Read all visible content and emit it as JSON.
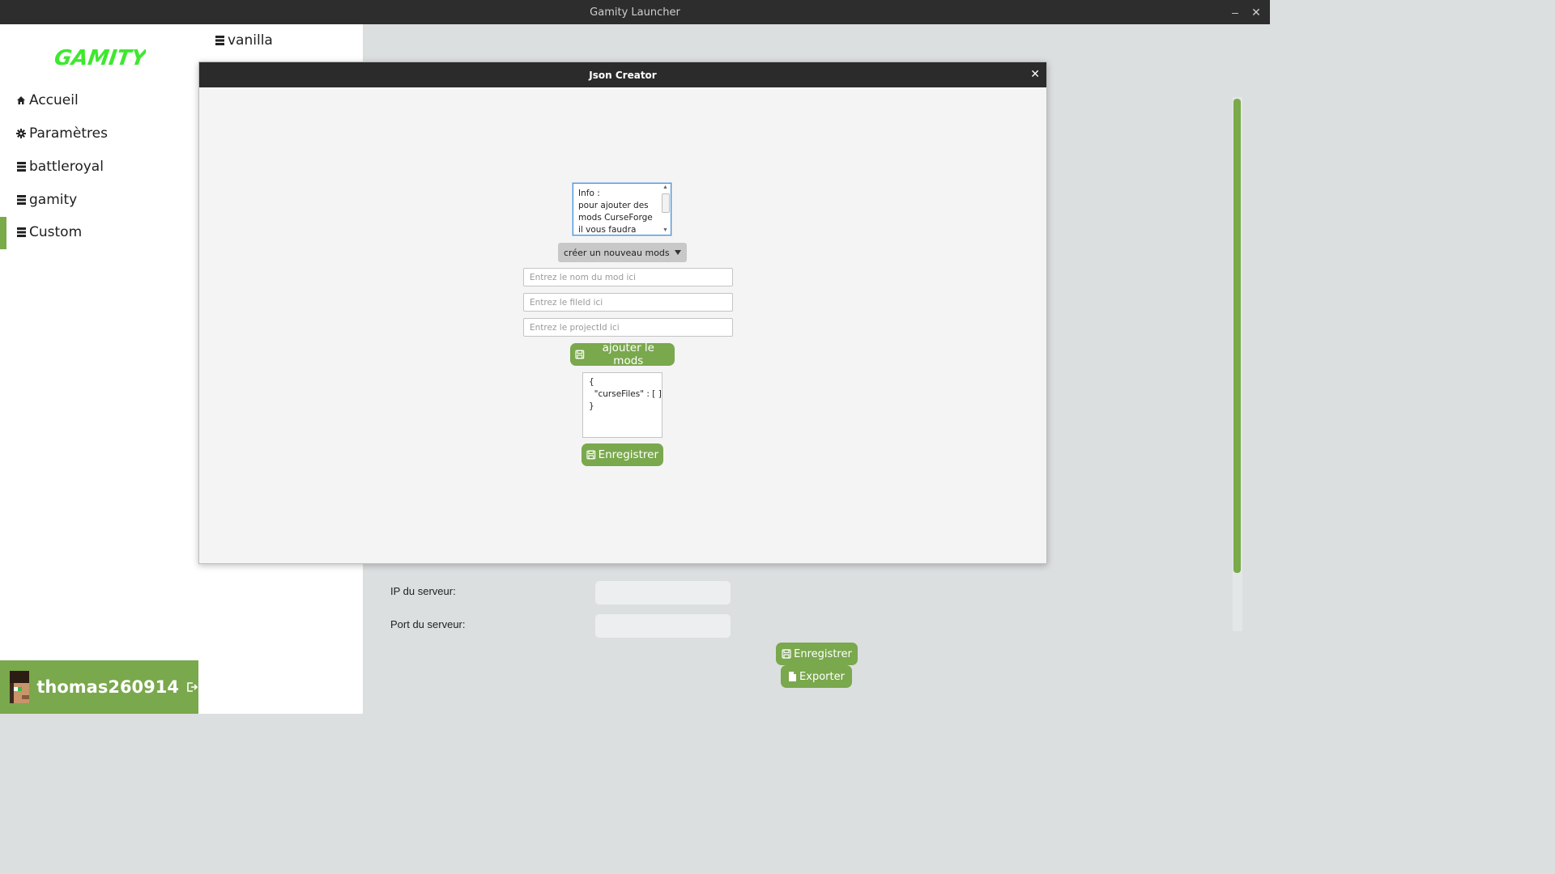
{
  "window": {
    "title": "Gamity Launcher",
    "minimize_icon": "minimize-icon",
    "close_icon": "close-icon"
  },
  "sidebar": {
    "logo_text": "GAMITY",
    "items": [
      {
        "label": "Accueil",
        "icon": "home-icon"
      },
      {
        "label": "Paramètres",
        "icon": "gear-icon"
      },
      {
        "label": "battleroyal",
        "icon": "server-icon"
      },
      {
        "label": "gamity",
        "icon": "server-icon"
      },
      {
        "label": "Custom",
        "icon": "server-icon",
        "active": true
      }
    ],
    "user": {
      "name": "thomas260914",
      "logout_icon": "logout-icon"
    }
  },
  "column2": {
    "items": [
      {
        "label": "vanilla",
        "icon": "server-icon"
      }
    ]
  },
  "main": {
    "server_ip_label": "IP du serveur:",
    "server_ip_value": "",
    "server_port_label": "Port du serveur:",
    "server_port_value": "",
    "save_label": "Enregistrer",
    "export_label": "Exporter"
  },
  "dialog": {
    "title": "Json Creator",
    "info_text": "Info :\npour ajouter des\nmods CurseForge\nil vous faudra",
    "mode_select": "créer un nouveau mods",
    "mod_name_placeholder": "Entrez le nom du mod ici",
    "file_id_placeholder": "Entrez le fileId ici",
    "project_id_placeholder": "Entrez le projectId ici",
    "add_mod_label": "ajouter le mods",
    "json_preview": "{\n  \"curseFiles\" : [ ]\n}",
    "save_label": "Enregistrer"
  },
  "colors": {
    "accent_green": "#7aa84d",
    "title_bar": "#2d2d2d",
    "logo_green": "#3ee82e"
  }
}
